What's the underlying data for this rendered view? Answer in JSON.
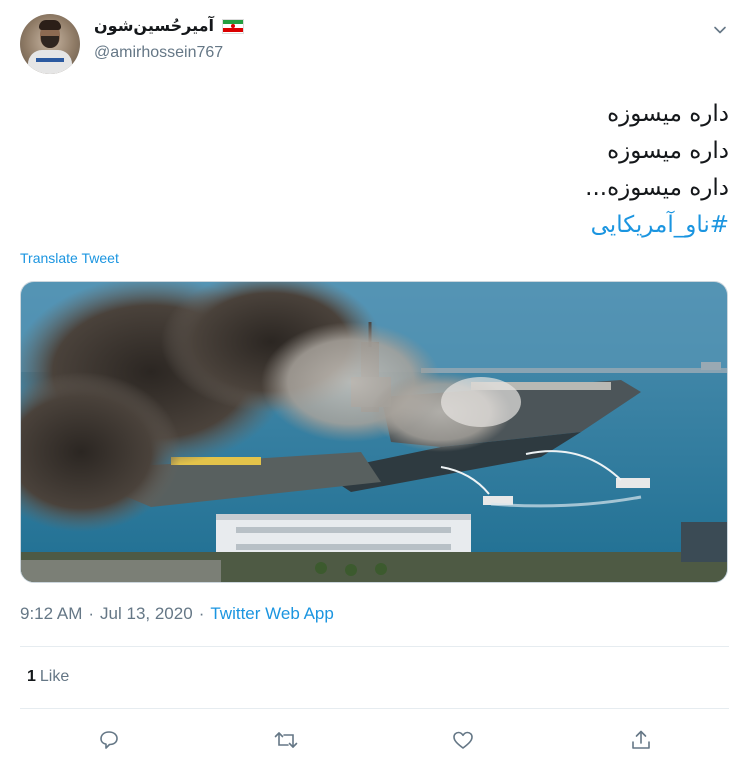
{
  "user": {
    "display_name": "آمیرحُسین‌شون",
    "handle": "@amirhossein767",
    "flag": "iran-flag-icon"
  },
  "tweet": {
    "lines": [
      "داره میسوزه",
      "داره میسوزه",
      "داره میسوزه..."
    ],
    "hashtag": "#ناو_آمریکایی",
    "translate_label": "Translate Tweet",
    "time": "9:12 AM",
    "date": "Jul 13, 2020",
    "separator": "·",
    "source": "Twitter Web App"
  },
  "stats": {
    "likes_count": "1",
    "likes_label": "Like"
  },
  "actions": [
    {
      "name": "reply",
      "icon": "reply-icon"
    },
    {
      "name": "retweet",
      "icon": "retweet-icon"
    },
    {
      "name": "like",
      "icon": "heart-icon"
    },
    {
      "name": "share",
      "icon": "share-icon"
    }
  ],
  "colors": {
    "link": "#1b95e0",
    "secondary_text": "#657786",
    "divider": "#e6ecf0"
  }
}
